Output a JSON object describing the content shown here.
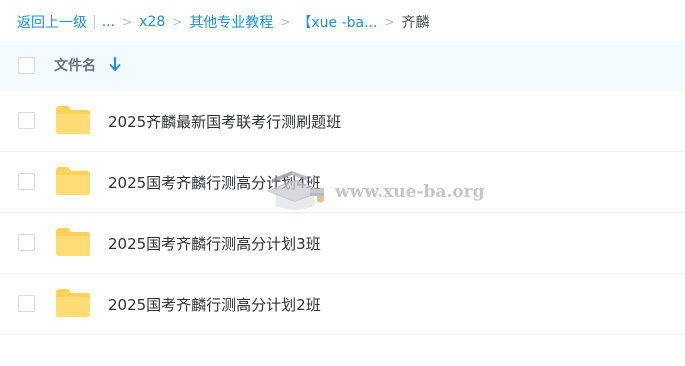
{
  "breadcrumb": {
    "back_label": "返回上一级",
    "ellipsis_label": "...",
    "items": [
      "x28",
      "其他专业教程",
      "【xue -ba..."
    ],
    "current": "齐麟",
    "separator": ">",
    "divider": "|"
  },
  "list_header": {
    "column_label": "文件名",
    "sort_icon": "arrow-down-icon"
  },
  "files": [
    {
      "name": "2025齐麟最新国考联考行测刷题班",
      "icon": "folder-icon"
    },
    {
      "name": "2025国考齐麟行测高分计划4班",
      "icon": "folder-icon"
    },
    {
      "name": "2025国考齐麟行测高分计划3班",
      "icon": "folder-icon"
    },
    {
      "name": "2025国考齐麟行测高分计划2班",
      "icon": "folder-icon"
    }
  ],
  "watermark": {
    "text": "www.xue-ba.org",
    "icon": "graduation-cap-logo"
  },
  "colors": {
    "link": "#1f8fd8",
    "header_bg": "#f4fbff",
    "folder": "#ffd25c"
  }
}
